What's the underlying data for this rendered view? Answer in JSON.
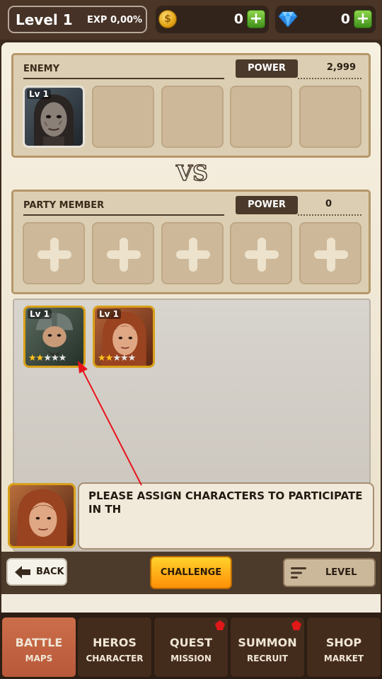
{
  "header": {
    "level_label": "Level 1",
    "exp_label": "EXP 0,00%",
    "gold_value": "0",
    "gem_value": "0",
    "gold_icon_glyph": "$"
  },
  "enemy": {
    "title": "ENEMY",
    "power_label": "POWER",
    "power_value": "2,999",
    "portrait_level": "Lv 1"
  },
  "vs_label": "VS",
  "party": {
    "title": "PARTY MEMBER",
    "power_label": "POWER",
    "power_value": "0"
  },
  "roster": [
    {
      "level": "Lv 1",
      "stars_filled": 2,
      "stars_total": 5
    },
    {
      "level": "Lv 1",
      "stars_filled": 2,
      "stars_total": 5
    }
  ],
  "dialog": {
    "text": "PLEASE ASSIGN CHARACTERS TO PARTICIPATE IN TH"
  },
  "actions": {
    "back_label": "BACK",
    "challenge_label": "CHALLENGE",
    "level_label": "LEVEL"
  },
  "nav": [
    {
      "main": "BATTLE",
      "sub": "MAPS"
    },
    {
      "main": "HEROS",
      "sub": "CHARACTER"
    },
    {
      "main": "QUEST",
      "sub": "MISSION"
    },
    {
      "main": "SUMMON",
      "sub": "RECRUIT"
    },
    {
      "main": "SHOP",
      "sub": "MARKET"
    }
  ],
  "colors": {
    "accent_orange": "#ff8f08",
    "nav_active": "#cc6e4a",
    "panel_border": "#b5976a"
  }
}
